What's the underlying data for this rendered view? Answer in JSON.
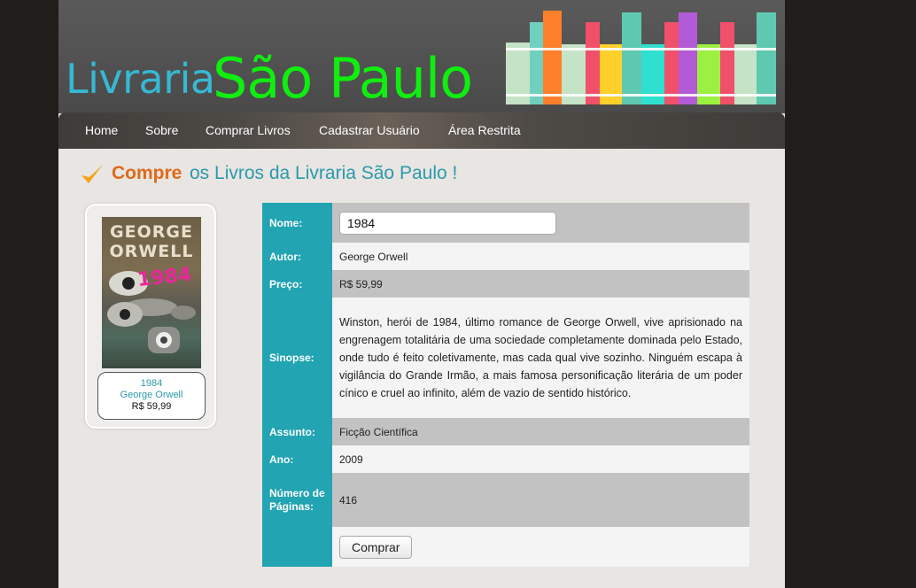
{
  "header": {
    "logo_word1": "Livraria",
    "logo_word2": "São Paulo"
  },
  "nav": {
    "items": [
      "Home",
      "Sobre",
      "Comprar Livros",
      "Cadastrar Usuário",
      "Área Restrita"
    ]
  },
  "heading": {
    "strong": "Compre",
    "rest": "os Livros da Livraria São Paulo !"
  },
  "book_card": {
    "cover_author_line1": "GEORGE",
    "cover_author_line2": "ORWELL",
    "cover_title": "1984",
    "title": "1984",
    "author": "George Orwell",
    "price": "R$ 59,99"
  },
  "details": {
    "nome_label": "Nome:",
    "nome_value": "1984",
    "autor_label": "Autor:",
    "autor_value": "George Orwell",
    "preco_label": "Preço:",
    "preco_value": "R$ 59,99",
    "sinopse_label": "Sinopse:",
    "sinopse_value": "Winston, herói de 1984, último romance de George Orwell, vive aprisionado na engrenagem totalitária de uma sociedade completamente dominada pelo Estado, onde tudo é feito coletivamente, mas cada qual vive sozinho. Ninguém escapa à vigilância do Grande Irmão, a mais famosa personificação literária de um poder cínico e cruel ao infinito, além de vazio de sentido histórico.",
    "assunto_label": "Assunto:",
    "assunto_value": "Ficção Científica",
    "ano_label": "Ano:",
    "ano_value": "2009",
    "paginas_label": "Número de Páginas:",
    "paginas_value": "416",
    "buy_label": "Comprar"
  },
  "colors": {
    "accent": "#22a4b2",
    "logo_green": "#10ee10",
    "logo_blue": "#37b8d3",
    "highlight": "#e06a18"
  }
}
